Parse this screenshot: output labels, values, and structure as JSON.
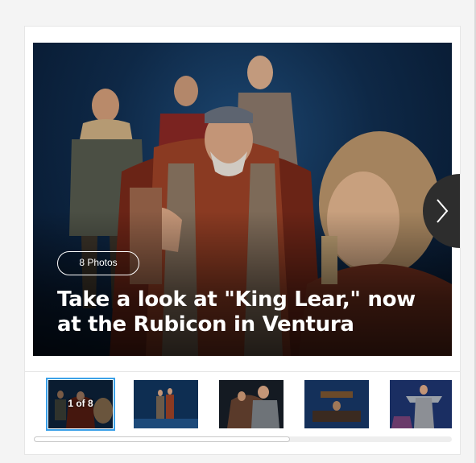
{
  "gallery": {
    "photo_count_label": "8 Photos",
    "title": "Take a look at \"King Lear,\" now at the Rubicon in Ventura",
    "next_icon": "chevron-right-icon"
  },
  "thumbnails": {
    "active_label": "1 of 8",
    "items": [
      {
        "name": "thumbnail-1",
        "active": true
      },
      {
        "name": "thumbnail-2",
        "active": false
      },
      {
        "name": "thumbnail-3",
        "active": false
      },
      {
        "name": "thumbnail-4",
        "active": false
      },
      {
        "name": "thumbnail-5",
        "active": false
      }
    ]
  },
  "scroll": {
    "position_fraction": 0.0,
    "visible_fraction": 0.61
  },
  "colors": {
    "active_outline": "#3aa0e8",
    "nav_button": "#2d2d2d"
  }
}
